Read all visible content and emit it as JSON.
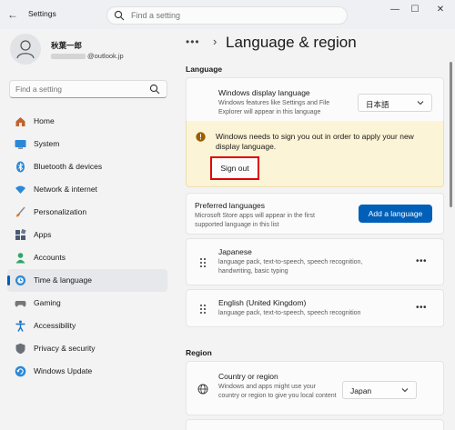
{
  "window": {
    "title": "Settings",
    "search_placeholder": "Find a setting"
  },
  "profile": {
    "name": "秋葉一郎",
    "email_domain": "@outlook.jp"
  },
  "sidebar": {
    "search_placeholder": "Find a setting",
    "items": [
      {
        "label": "Home",
        "icon": "home-icon",
        "color": "#c0632d"
      },
      {
        "label": "System",
        "icon": "monitor-icon",
        "color": "#2b88d8"
      },
      {
        "label": "Bluetooth & devices",
        "icon": "bluetooth-icon",
        "color": "#2b88d8"
      },
      {
        "label": "Network & internet",
        "icon": "wifi-icon",
        "color": "#2b88d8"
      },
      {
        "label": "Personalization",
        "icon": "brush-icon",
        "color": "#d87a2b"
      },
      {
        "label": "Apps",
        "icon": "apps-icon",
        "color": "#4a5a73"
      },
      {
        "label": "Accounts",
        "icon": "person-icon",
        "color": "#2ea56a"
      },
      {
        "label": "Time & language",
        "icon": "globe-clock-icon",
        "color": "#2b88d8"
      },
      {
        "label": "Gaming",
        "icon": "gamepad-icon",
        "color": "#777777"
      },
      {
        "label": "Accessibility",
        "icon": "accessibility-icon",
        "color": "#1a73c8"
      },
      {
        "label": "Privacy & security",
        "icon": "shield-icon",
        "color": "#6b6f78"
      },
      {
        "label": "Windows Update",
        "icon": "update-icon",
        "color": "#2b88d8"
      }
    ],
    "active_index": 7
  },
  "breadcrumb": {
    "more": "•••",
    "separator": "›",
    "title": "Language & region"
  },
  "language_section": {
    "heading": "Language",
    "display_language": {
      "title": "Windows display language",
      "description": "Windows features like Settings and File Explorer will appear in this language",
      "value": "日本語"
    },
    "warning": {
      "text": "Windows needs to sign you out in order to apply your new display language.",
      "button": "Sign out"
    },
    "preferred": {
      "title": "Preferred languages",
      "description": "Microsoft Store apps will appear in the first supported language in this list",
      "button": "Add a language"
    },
    "languages": [
      {
        "name": "Japanese",
        "details": "language pack, text-to-speech, speech recognition, handwriting, basic typing"
      },
      {
        "name": "English (United Kingdom)",
        "details": "language pack, text-to-speech, speech recognition"
      }
    ],
    "more_label": "•••"
  },
  "region_section": {
    "heading": "Region",
    "country": {
      "title": "Country or region",
      "description": "Windows and apps might use your country or region to give you local content",
      "value": "Japan"
    }
  },
  "colors": {
    "accent": "#005fb8",
    "warning_bg": "#fcf4d6",
    "warning_icon": "#9d5d00",
    "highlight_border": "#e00000"
  }
}
